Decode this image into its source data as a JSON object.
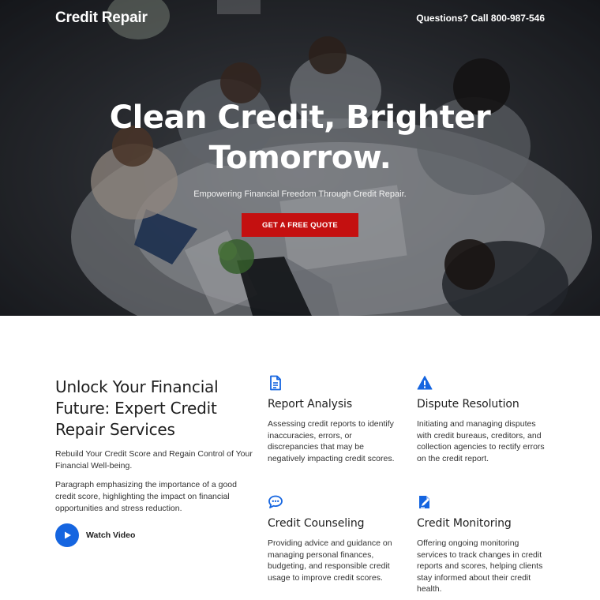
{
  "header": {
    "logo": "Credit Repair",
    "phone": "Questions? Call 800-987-546"
  },
  "hero": {
    "title_line1": "Clean Credit, Brighter",
    "title_line2": "Tomorrow.",
    "subtitle": "Empowering Financial Freedom Through Credit Repair.",
    "cta_label": "GET A FREE QUOTE"
  },
  "intro": {
    "title": "Unlock Your Financial Future: Expert Credit Repair Services",
    "lead": "Rebuild Your Credit Score and Regain Control of Your Financial Well-being.",
    "paragraph": "Paragraph emphasizing the importance of a good credit score, highlighting the impact on financial opportunities and stress reduction.",
    "watch_label": "Watch Video"
  },
  "features": [
    {
      "icon": "document-icon",
      "title": "Report Analysis",
      "description": "Assessing credit reports to identify inaccuracies, errors, or discrepancies that may be negatively impacting credit scores."
    },
    {
      "icon": "warning-icon",
      "title": "Dispute Resolution",
      "description": "Initiating and managing disputes with credit bureaus, creditors, and collection agencies to rectify errors on the credit report."
    },
    {
      "icon": "chat-icon",
      "title": "Credit Counseling",
      "description": "Providing advice and guidance on managing personal finances, budgeting, and responsible credit usage to improve credit scores."
    },
    {
      "icon": "edit-document-icon",
      "title": "Credit Monitoring",
      "description": "Offering ongoing monitoring services to track changes in credit reports and scores, helping clients stay informed about their credit health."
    }
  ],
  "colors": {
    "accent_red": "#c41010",
    "accent_blue": "#1565e0"
  }
}
